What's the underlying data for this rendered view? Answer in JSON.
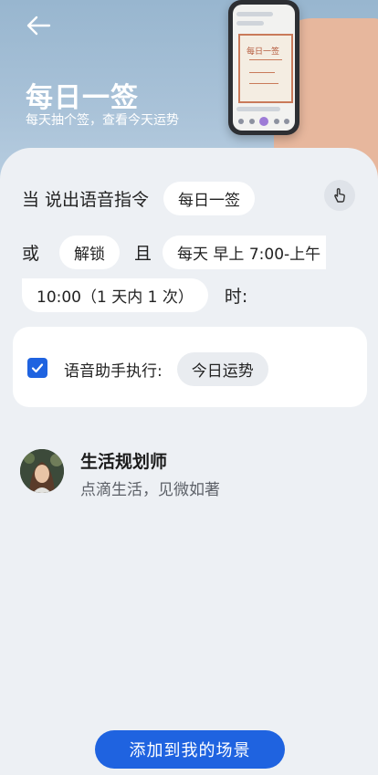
{
  "hero": {
    "title": "每日一签",
    "subtitle": "每天抽个签，查看今天运势",
    "phone_card_text": "每日一签"
  },
  "trigger": {
    "prefix": "当 说出语音指令",
    "command_pill": "每日一签",
    "or": "或",
    "unlock_pill": "解锁",
    "and": "且",
    "schedule_pill": "每天 早上 7:00-上午",
    "schedule_pill_cont": "10:00（1 天内 1 次）",
    "when": "时:"
  },
  "execute": {
    "label": "语音助手执行:",
    "action_pill": "今日运势",
    "checked": true
  },
  "provider": {
    "name": "生活规划师",
    "description": "点滴生活，见微如著"
  },
  "cta": {
    "label": "添加到我的场景"
  },
  "colors": {
    "accent": "#1f63e0",
    "hero": "#a9c2d8"
  },
  "icons": {
    "back": "arrow-left-icon",
    "touch": "hand-pointer-icon",
    "check": "checkmark-icon"
  }
}
